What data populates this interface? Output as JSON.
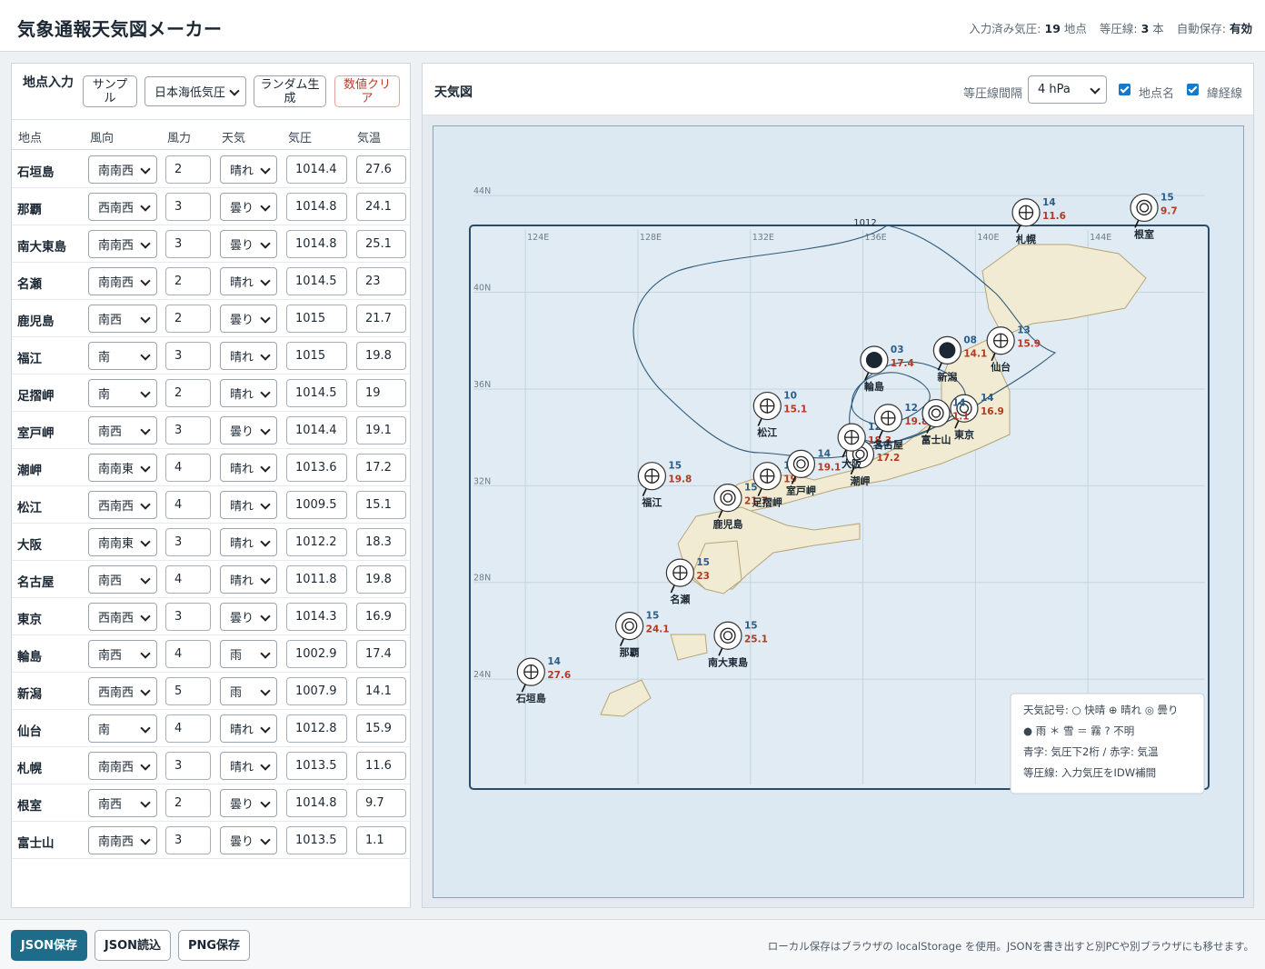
{
  "header": {
    "title": "気象通報天気図メーカー",
    "stats": [
      {
        "label": "入力済み気圧:",
        "value": "19",
        "unit": "地点"
      },
      {
        "label": "等圧線:",
        "value": "3",
        "unit": "本"
      },
      {
        "label": "自動保存:",
        "value": "有効",
        "unit": ""
      }
    ]
  },
  "input_panel": {
    "title": "地点入力",
    "sample_button": "サンプル",
    "preset_select": "日本海低気圧",
    "random_button": "ランダム生成",
    "clear_button": "数値クリア",
    "columns": [
      "地点",
      "風向",
      "風力",
      "天気",
      "気圧",
      "気温"
    ],
    "rows": [
      {
        "name": "石垣島",
        "dir": "南南西",
        "force": "2",
        "weather": "晴れ",
        "pressure": "1014.4",
        "temp": "27.6"
      },
      {
        "name": "那覇",
        "dir": "西南西",
        "force": "3",
        "weather": "曇り",
        "pressure": "1014.8",
        "temp": "24.1"
      },
      {
        "name": "南大東島",
        "dir": "南南西",
        "force": "3",
        "weather": "曇り",
        "pressure": "1014.8",
        "temp": "25.1"
      },
      {
        "name": "名瀬",
        "dir": "南南西",
        "force": "2",
        "weather": "晴れ",
        "pressure": "1014.5",
        "temp": "23"
      },
      {
        "name": "鹿児島",
        "dir": "南西",
        "force": "2",
        "weather": "曇り",
        "pressure": "1015",
        "temp": "21.7"
      },
      {
        "name": "福江",
        "dir": "南",
        "force": "3",
        "weather": "晴れ",
        "pressure": "1015",
        "temp": "19.8"
      },
      {
        "name": "足摺岬",
        "dir": "南",
        "force": "2",
        "weather": "晴れ",
        "pressure": "1014.5",
        "temp": "19"
      },
      {
        "name": "室戸岬",
        "dir": "南西",
        "force": "3",
        "weather": "曇り",
        "pressure": "1014.4",
        "temp": "19.1"
      },
      {
        "name": "潮岬",
        "dir": "南南東",
        "force": "4",
        "weather": "晴れ",
        "pressure": "1013.6",
        "temp": "17.2"
      },
      {
        "name": "松江",
        "dir": "西南西",
        "force": "4",
        "weather": "晴れ",
        "pressure": "1009.5",
        "temp": "15.1"
      },
      {
        "name": "大阪",
        "dir": "南南東",
        "force": "3",
        "weather": "晴れ",
        "pressure": "1012.2",
        "temp": "18.3"
      },
      {
        "name": "名古屋",
        "dir": "南西",
        "force": "4",
        "weather": "晴れ",
        "pressure": "1011.8",
        "temp": "19.8"
      },
      {
        "name": "東京",
        "dir": "西南西",
        "force": "3",
        "weather": "曇り",
        "pressure": "1014.3",
        "temp": "16.9"
      },
      {
        "name": "輪島",
        "dir": "南西",
        "force": "4",
        "weather": "雨",
        "pressure": "1002.9",
        "temp": "17.4"
      },
      {
        "name": "新潟",
        "dir": "西南西",
        "force": "5",
        "weather": "雨",
        "pressure": "1007.9",
        "temp": "14.1"
      },
      {
        "name": "仙台",
        "dir": "南",
        "force": "4",
        "weather": "晴れ",
        "pressure": "1012.8",
        "temp": "15.9"
      },
      {
        "name": "札幌",
        "dir": "南南西",
        "force": "3",
        "weather": "晴れ",
        "pressure": "1013.5",
        "temp": "11.6"
      },
      {
        "name": "根室",
        "dir": "南西",
        "force": "2",
        "weather": "曇り",
        "pressure": "1014.8",
        "temp": "9.7"
      },
      {
        "name": "富士山",
        "dir": "南南西",
        "force": "3",
        "weather": "曇り",
        "pressure": "1013.5",
        "temp": "1.1"
      }
    ]
  },
  "map_panel": {
    "title": "天気図",
    "interval_label": "等圧線間隔",
    "interval_value": "4 hPa",
    "show_names_label": "地点名",
    "show_grid_label": "緯経線",
    "isobar_label": "1012",
    "lon_labels": [
      "124E",
      "128E",
      "132E",
      "136E",
      "140E",
      "144E"
    ],
    "lat_labels": [
      "44N",
      "40N",
      "36N",
      "32N",
      "28N",
      "24N"
    ],
    "legend": [
      "天気記号: ○ 快晴 ⊕ 晴れ ◎ 曇り",
      "● 雨 ＊ 雪 ＝ 霧 ? 不明",
      "青字: 気圧下2桁 / 赤字: 気温",
      "等圧線: 入力気圧をIDW補間"
    ],
    "stations": [
      {
        "name": "石垣島",
        "p": "14",
        "t": "27.6",
        "wx": "fair",
        "lon": 124.2,
        "lat": 24.3
      },
      {
        "name": "那覇",
        "p": "15",
        "t": "24.1",
        "wx": "cloudy",
        "lon": 127.7,
        "lat": 26.2
      },
      {
        "name": "南大東島",
        "p": "15",
        "t": "25.1",
        "wx": "cloudy",
        "lon": 131.2,
        "lat": 25.8
      },
      {
        "name": "名瀬",
        "p": "15",
        "t": "23",
        "wx": "fair",
        "lon": 129.5,
        "lat": 28.4
      },
      {
        "name": "鹿児島",
        "p": "15",
        "t": "21.7",
        "wx": "cloudy",
        "lon": 131.2,
        "lat": 31.5
      },
      {
        "name": "福江",
        "p": "15",
        "t": "19.8",
        "wx": "fair",
        "lon": 128.5,
        "lat": 32.4
      },
      {
        "name": "足摺岬",
        "p": "15",
        "t": "19",
        "wx": "fair",
        "lon": 132.6,
        "lat": 32.4
      },
      {
        "name": "室戸岬",
        "p": "14",
        "t": "19.1",
        "wx": "cloudy",
        "lon": 133.8,
        "lat": 32.9
      },
      {
        "name": "潮岬",
        "p": "14",
        "t": "17.2",
        "wx": "cloudy",
        "lon": 135.9,
        "lat": 33.3
      },
      {
        "name": "松江",
        "p": "10",
        "t": "15.1",
        "wx": "fair",
        "lon": 132.6,
        "lat": 35.3
      },
      {
        "name": "大阪",
        "p": "12",
        "t": "18.3",
        "wx": "fair",
        "lon": 135.6,
        "lat": 34.0
      },
      {
        "name": "名古屋",
        "p": "12",
        "t": "19.8",
        "wx": "fair",
        "lon": 136.9,
        "lat": 34.8
      },
      {
        "name": "東京",
        "p": "14",
        "t": "16.9",
        "wx": "cloudy",
        "lon": 139.6,
        "lat": 35.2
      },
      {
        "name": "輪島",
        "p": "03",
        "t": "17.4",
        "wx": "rain",
        "lon": 136.4,
        "lat": 37.2
      },
      {
        "name": "新潟",
        "p": "08",
        "t": "14.1",
        "wx": "rain",
        "lon": 139.0,
        "lat": 37.6
      },
      {
        "name": "仙台",
        "p": "13",
        "t": "15.9",
        "wx": "fair",
        "lon": 140.9,
        "lat": 38.0
      },
      {
        "name": "札幌",
        "p": "14",
        "t": "11.6",
        "wx": "fair",
        "lon": 141.8,
        "lat": 43.3
      },
      {
        "name": "根室",
        "p": "15",
        "t": "9.7",
        "wx": "cloudy",
        "lon": 146.0,
        "lat": 43.5
      },
      {
        "name": "富士山",
        "p": "14",
        "t": "1.1",
        "wx": "cloudy",
        "lon": 138.6,
        "lat": 35.0
      }
    ]
  },
  "footer": {
    "save_json": "JSON保存",
    "load_json": "JSON読込",
    "save_png": "PNG保存",
    "note": "ローカル保存はブラウザの localStorage を使用。JSONを書き出すと別PCや別ブラウザにも移せます。"
  },
  "colors": {
    "accent": "#1f6b8a",
    "pressure_text": "#2a5d8a",
    "temp_text": "#b23a22",
    "land": "#f2ebd3",
    "sea": "#dde9f2"
  }
}
